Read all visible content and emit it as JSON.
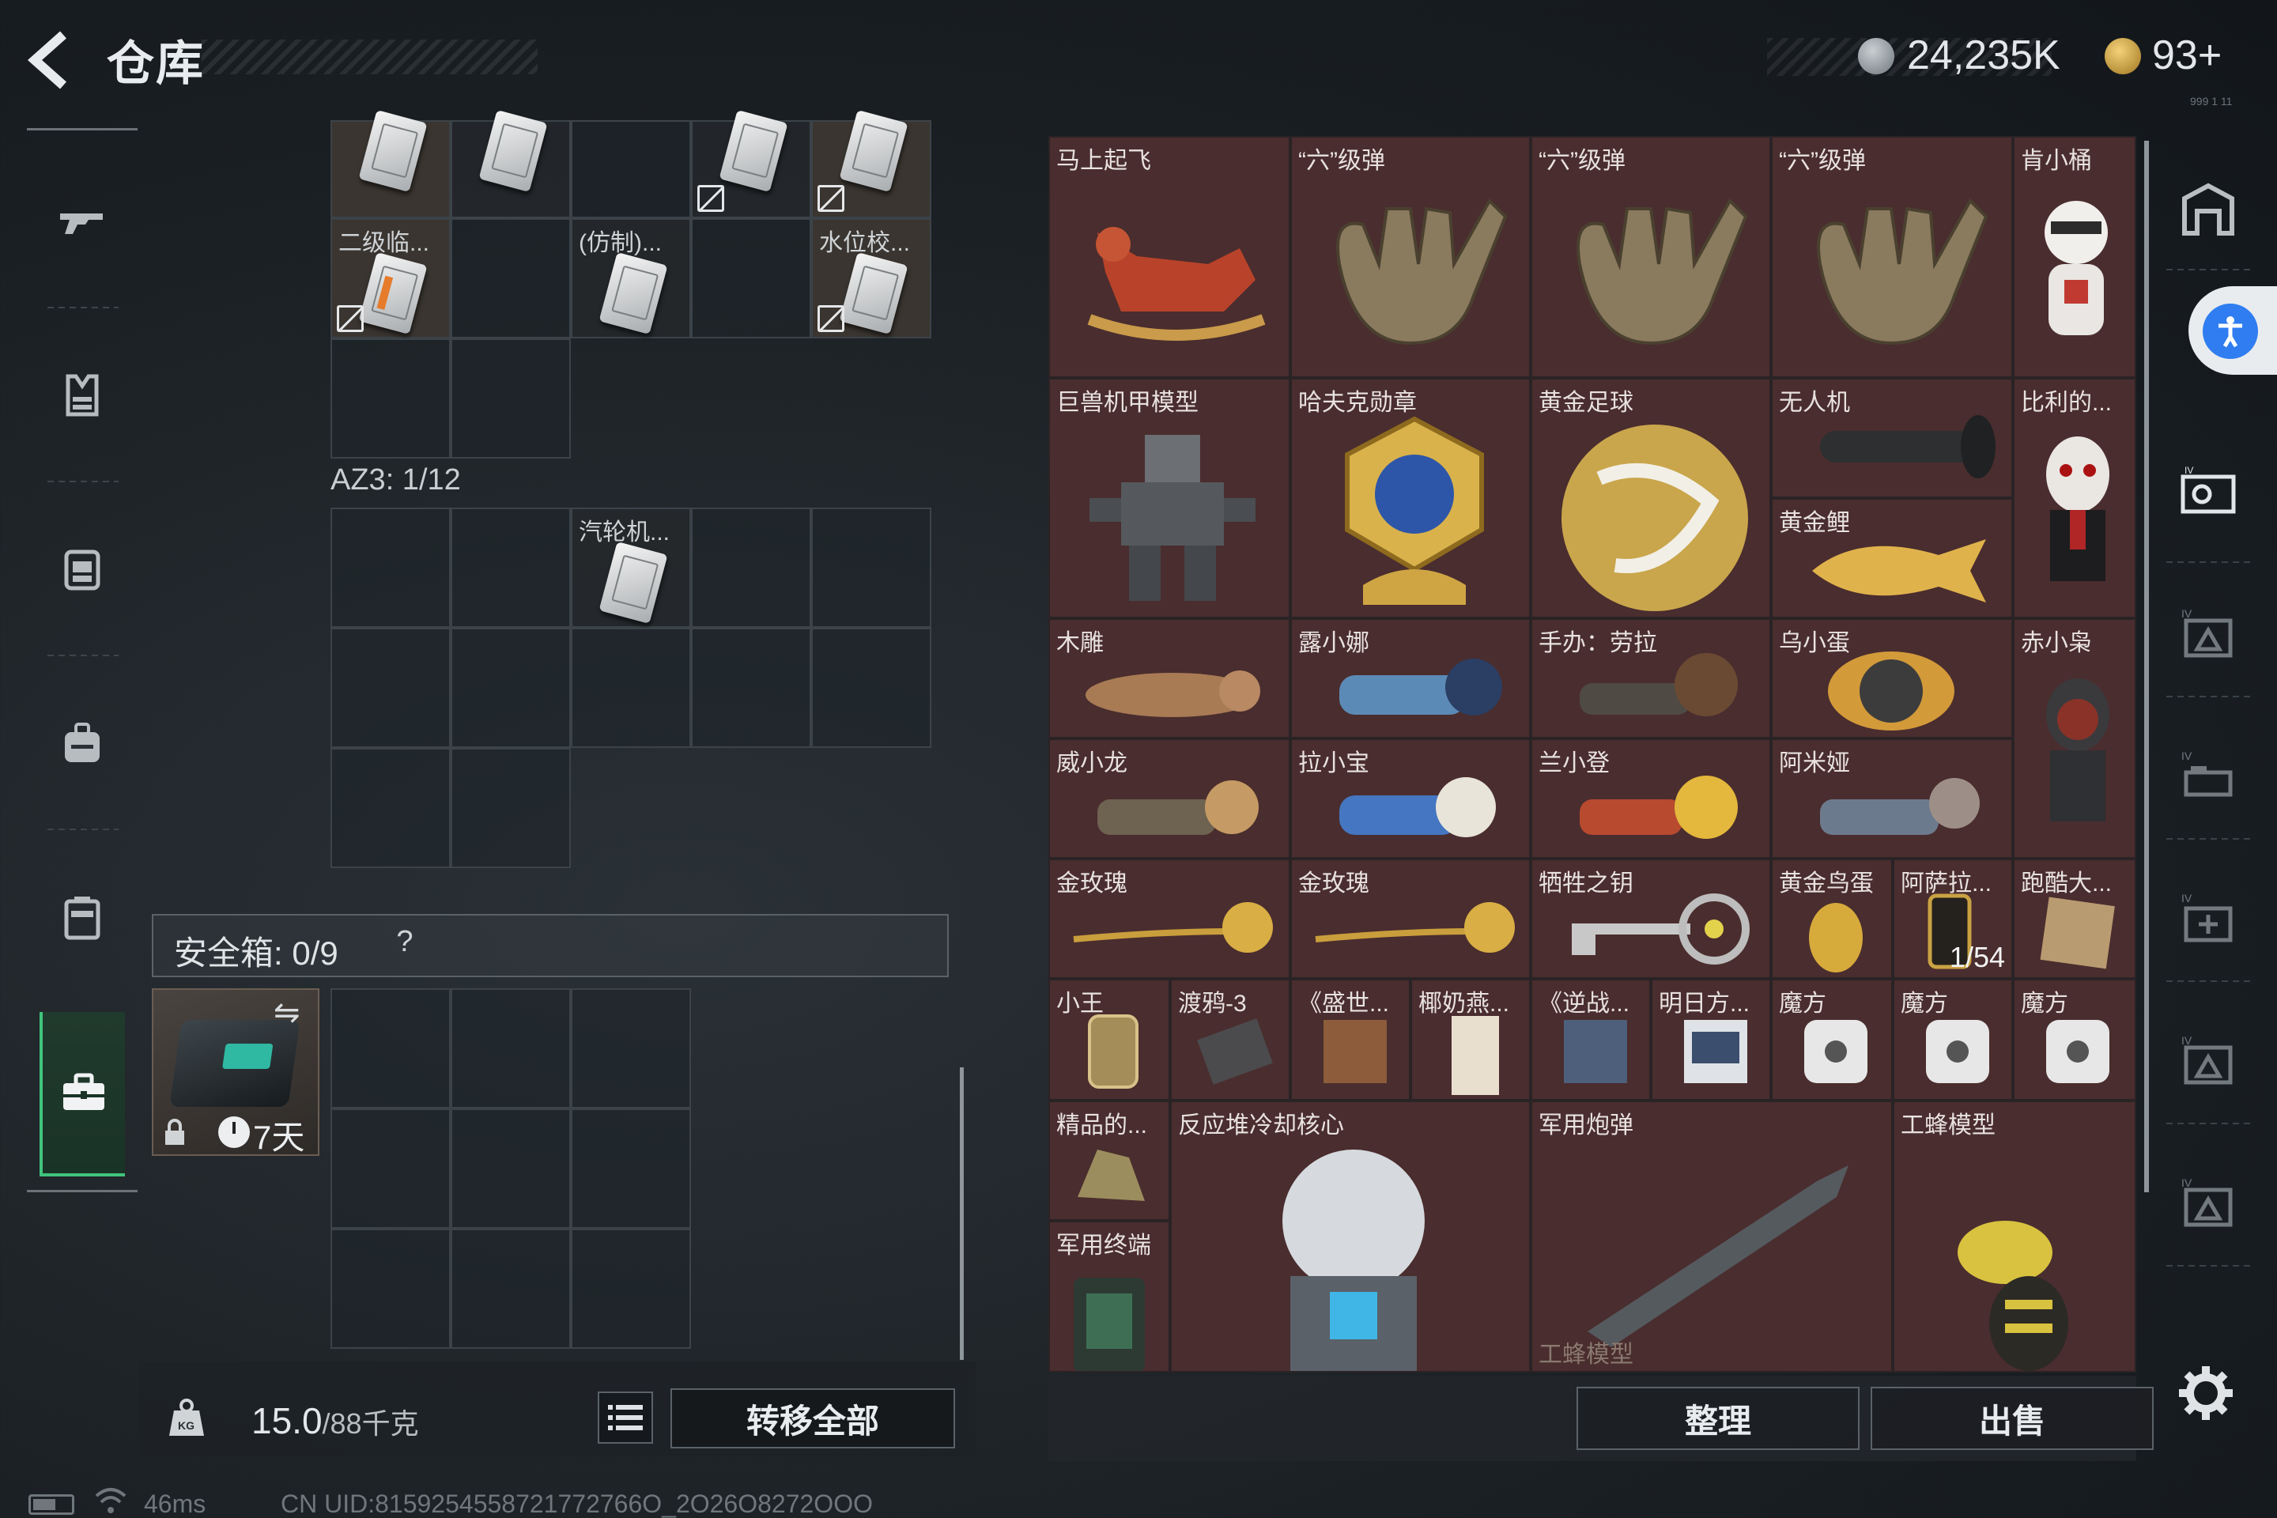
{
  "header": {
    "title": "仓库",
    "currency1": "24,235K",
    "currency2": "93+",
    "corner_mark": "999 1 11"
  },
  "left_grid": {
    "top_items": [
      {
        "label": "二级临..."
      },
      {
        "label": "(仿制)..."
      },
      {
        "label": "水位校..."
      }
    ],
    "az_label": "AZ3: 1/12",
    "az_item": "汽轮机..."
  },
  "safebox": {
    "label": "安全箱:",
    "count": "0/9",
    "help": "?",
    "case_days": "7天"
  },
  "weight": {
    "current": "15.0",
    "max": "/88千克"
  },
  "buttons": {
    "transfer_all": "转移全部",
    "sort": "整理",
    "sell": "出售"
  },
  "stash": {
    "items": [
      {
        "label": "马上起飞"
      },
      {
        "label": "“六”级弹"
      },
      {
        "label": "“六”级弹"
      },
      {
        "label": "“六”级弹"
      },
      {
        "label": "肯小桶"
      },
      {
        "label": "巨兽机甲模型"
      },
      {
        "label": "哈夫克勋章"
      },
      {
        "label": "黄金足球"
      },
      {
        "label": "无人机"
      },
      {
        "label": "黄金鲤"
      },
      {
        "label": "比利的..."
      },
      {
        "label": "木雕"
      },
      {
        "label": "露小娜"
      },
      {
        "label": "手办：劳拉"
      },
      {
        "label": "乌小蛋"
      },
      {
        "label": "赤小枭"
      },
      {
        "label": "威小龙"
      },
      {
        "label": "拉小宝"
      },
      {
        "label": "兰小登"
      },
      {
        "label": "阿米娅"
      },
      {
        "label": "金玫瑰"
      },
      {
        "label": "金玫瑰"
      },
      {
        "label": "牺牲之钥"
      },
      {
        "label": "黄金鸟蛋"
      },
      {
        "label": "阿萨拉..."
      },
      {
        "label": "跑酷大..."
      },
      {
        "label": "小王"
      },
      {
        "label": "渡鸦-3"
      },
      {
        "label": "《盛世..."
      },
      {
        "label": "椰奶燕..."
      },
      {
        "label": "《逆战..."
      },
      {
        "label": "明日方..."
      },
      {
        "label": "魔方"
      },
      {
        "label": "魔方"
      },
      {
        "label": "魔方"
      },
      {
        "label": "精品的..."
      },
      {
        "label": "反应堆冷却核心"
      },
      {
        "label": "军用炮弹"
      },
      {
        "label": "工蜂模型"
      },
      {
        "label": "军用终端"
      },
      {
        "label": "工蜂模型"
      }
    ],
    "asala_count": "1/54"
  },
  "status_bar": {
    "ping": "46ms",
    "uid": "CN UID:8159254558721772766O_2O26O8272OOO"
  }
}
